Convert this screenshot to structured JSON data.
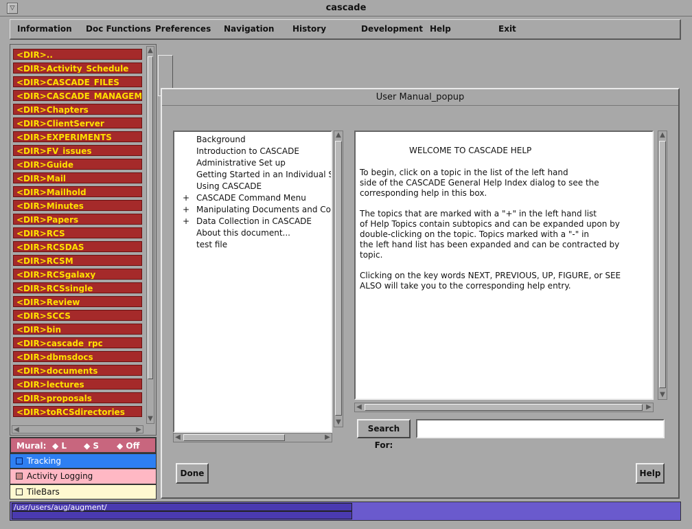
{
  "window": {
    "title": "cascade"
  },
  "menu": [
    "Information",
    "Doc Functions",
    "Preferences",
    "Navigation",
    "History",
    "Development",
    "Help",
    "Exit"
  ],
  "dirs": [
    "<DIR>..",
    "<DIR>Activity_Schedule",
    "<DIR>CASCADE_FILES",
    "<DIR>CASCADE_MANAGEMEN",
    "<DIR>Chapters",
    "<DIR>ClientServer",
    "<DIR>EXPERIMENTS",
    "<DIR>FV_issues",
    "<DIR>Guide",
    "<DIR>Mail",
    "<DIR>Mailhold",
    "<DIR>Minutes",
    "<DIR>Papers",
    "<DIR>RCS",
    "<DIR>RCSDAS",
    "<DIR>RCSM",
    "<DIR>RCSgalaxy",
    "<DIR>RCSsingle",
    "<DIR>Review",
    "<DIR>SCCS",
    "<DIR>bin",
    "<DIR>cascade_rpc",
    "<DIR>dbmsdocs",
    "<DIR>documents",
    "<DIR>lectures",
    "<DIR>proposals",
    "<DIR>toRCSdirectories"
  ],
  "mural": {
    "label": "Mural:",
    "options": [
      "L",
      "S",
      "Off"
    ]
  },
  "tracking": "Tracking",
  "activity_logging": "Activity Logging",
  "tilebars": "TileBars",
  "status": {
    "path": "/usr/users/aug/augment/"
  },
  "popup": {
    "title": "User Manual_popup",
    "topics": [
      {
        "label": "Background",
        "expand": ""
      },
      {
        "label": "Introduction to CASCADE",
        "expand": ""
      },
      {
        "label": "Administrative Set up",
        "expand": ""
      },
      {
        "label": "Getting Started in an Individual S",
        "expand": ""
      },
      {
        "label": "Using CASCADE",
        "expand": ""
      },
      {
        "label": "CASCADE Command Menu",
        "expand": "+"
      },
      {
        "label": "Manipulating Documents and Con",
        "expand": "+"
      },
      {
        "label": "Data Collection in CASCADE",
        "expand": "+"
      },
      {
        "label": "About this document...",
        "expand": ""
      },
      {
        "label": "test file",
        "expand": ""
      }
    ],
    "help_title": "WELCOME TO CASCADE HELP",
    "help_lines": [
      "To begin, click on a topic in the list of the left hand",
      "side of the CASCADE General Help Index dialog to see the",
      "corresponding help in this box.",
      "",
      "The topics that are marked with a \"+\" in the left hand list",
      "of Help Topics contain subtopics and can be expanded upon by",
      "double-clicking on the topic.  Topics marked with a \"-\" in",
      "the left hand list has been expanded and can be contracted by",
      "topic.",
      "",
      "Clicking on the key words NEXT, PREVIOUS, UP, FIGURE, or SEE",
      "ALSO will take you to the corresponding help entry."
    ],
    "search_label": "Search For:",
    "search_value": "",
    "done_label": "Done",
    "help_label": "Help"
  }
}
